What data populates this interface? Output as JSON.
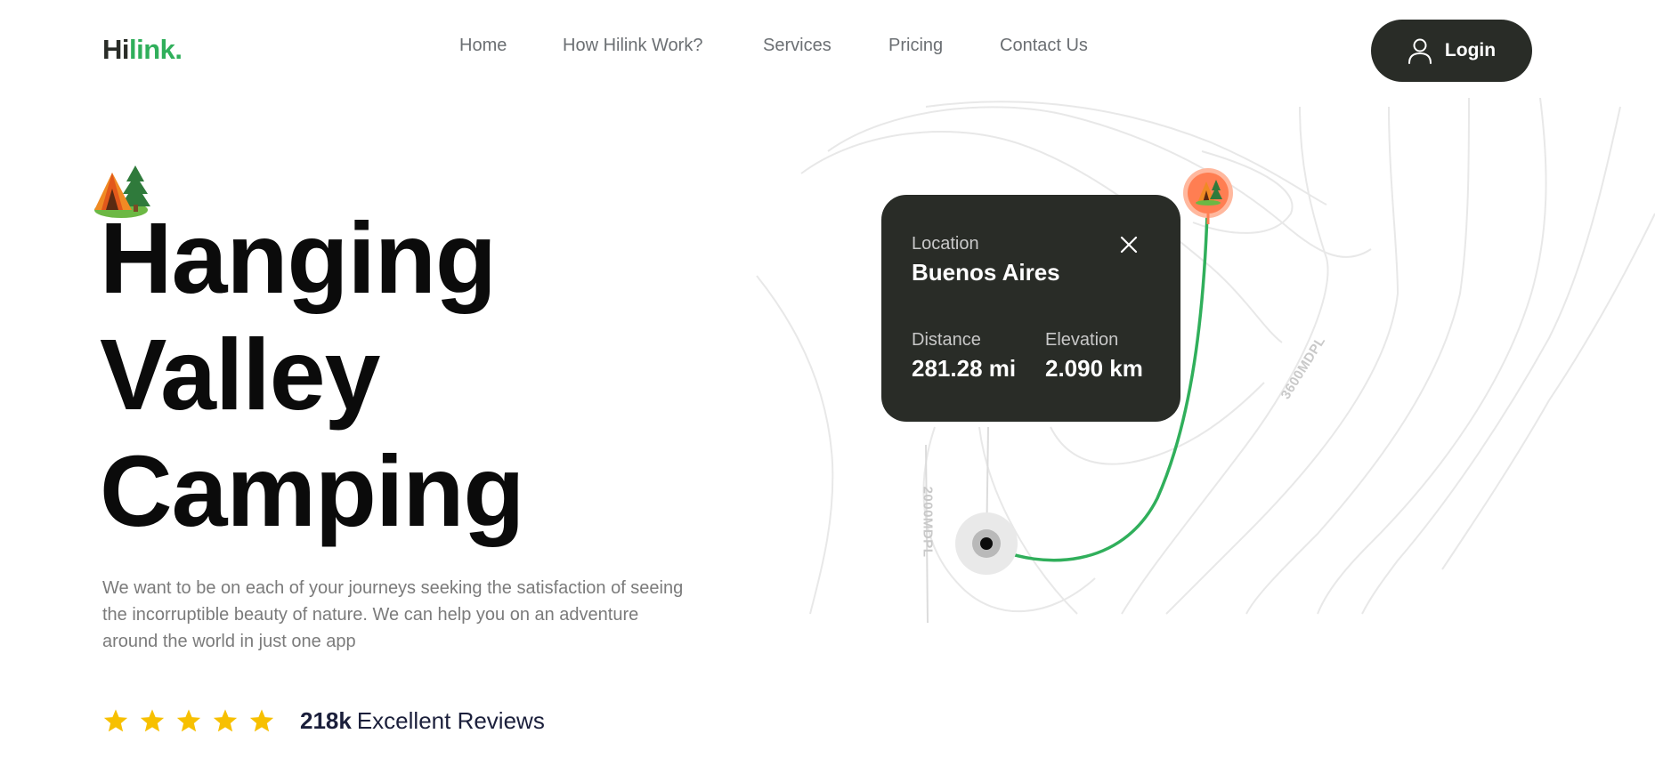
{
  "header": {
    "logo_part1": "Hi",
    "logo_part2": "link.",
    "nav": [
      {
        "label": "Home"
      },
      {
        "label": "How Hilink Work?"
      },
      {
        "label": "Services"
      },
      {
        "label": "Pricing"
      },
      {
        "label": "Contact Us"
      }
    ],
    "login_label": "Login",
    "login_icon": "user-icon"
  },
  "hero": {
    "badge_icon": "camping-tent-icon",
    "title_lines": [
      "Hanging",
      "Valley",
      "Camping"
    ],
    "description": "We want to be on each of your journeys seeking the satisfaction of seeing the incorruptible beauty of nature. We can help you on an adventure around the world in just one app",
    "rating_stars": 5,
    "reviews_count": "218k",
    "reviews_label": "Excellent Reviews"
  },
  "map": {
    "contour_labels": [
      "3600MDPL",
      "2000MDPL"
    ],
    "route_color": "#30af5b",
    "pin_color": "#ff7e52",
    "card": {
      "location_label": "Location",
      "location_value": "Buenos Aires",
      "distance_label": "Distance",
      "distance_value": "281.28 mi",
      "elevation_label": "Elevation",
      "elevation_value": "2.090 km",
      "close_icon": "close-icon"
    }
  },
  "colors": {
    "brand_dark": "#292c27",
    "brand_green": "#30af5b",
    "star": "#f7c000"
  }
}
